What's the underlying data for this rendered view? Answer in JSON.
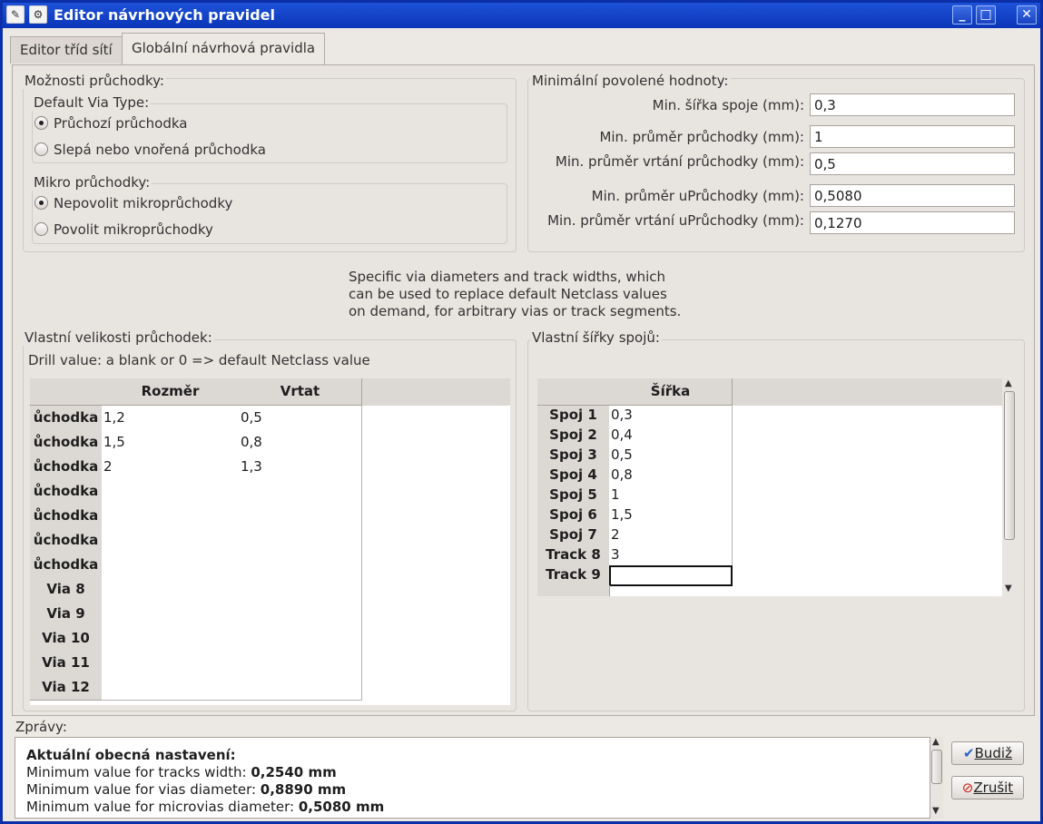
{
  "window": {
    "title": "Editor návrhových pravidel"
  },
  "tabs": [
    "Editor tříd sítí",
    "Globální návrhová pravidla"
  ],
  "via_options": {
    "title": "Možnosti průchodky:",
    "default_type": {
      "title": "Default Via Type:",
      "options": [
        "Průchozí průchodka",
        "Slepá nebo vnořená průchodka"
      ],
      "selected": 0
    },
    "micro": {
      "title": "Mikro průchodky:",
      "options": [
        "Nepovolit mikroprůchodky",
        "Povolit mikroprůchodky"
      ],
      "selected": 0
    }
  },
  "min_values": {
    "title": "Minimální povolené hodnoty:",
    "fields": [
      {
        "label": "Min. šířka spoje (mm):",
        "value": "0,3"
      },
      {
        "label": "Min. průměr průchodky (mm):",
        "value": "1"
      },
      {
        "label": "Min. průměr vrtání průchodky (mm):",
        "value": "0,5"
      },
      {
        "label": "Min. průměr uPrůchodky (mm):",
        "value": "0,5080"
      },
      {
        "label": "Min. průměr vrtání uPrůchodky (mm):",
        "value": "0,1270"
      }
    ]
  },
  "info_text": [
    "Specific via diameters and track widths, which",
    "can be used to replace default Netclass values",
    "on demand, for arbitrary vias or track segments."
  ],
  "via_sizes": {
    "title": "Vlastní velikosti průchodek:",
    "note": "Drill value: a blank or 0 => default Netclass value",
    "columns": [
      "Rozměr",
      "Vrtat"
    ],
    "rows": [
      {
        "label": "ůchodka",
        "size": "1,2",
        "drill": "0,5"
      },
      {
        "label": "ůchodka",
        "size": "1,5",
        "drill": "0,8"
      },
      {
        "label": "ůchodka",
        "size": "2",
        "drill": "1,3"
      },
      {
        "label": "ůchodka",
        "size": "",
        "drill": ""
      },
      {
        "label": "ůchodka",
        "size": "",
        "drill": ""
      },
      {
        "label": "ůchodka",
        "size": "",
        "drill": ""
      },
      {
        "label": "ůchodka",
        "size": "",
        "drill": ""
      },
      {
        "label": "Via 8",
        "size": "",
        "drill": ""
      },
      {
        "label": "Via 9",
        "size": "",
        "drill": ""
      },
      {
        "label": "Via 10",
        "size": "",
        "drill": ""
      },
      {
        "label": "Via 11",
        "size": "",
        "drill": ""
      },
      {
        "label": "Via 12",
        "size": "",
        "drill": ""
      }
    ]
  },
  "track_widths": {
    "title": "Vlastní šířky spojů:",
    "columns": [
      "Šířka"
    ],
    "rows": [
      {
        "label": "Spoj 1",
        "width": "0,3"
      },
      {
        "label": "Spoj 2",
        "width": "0,4"
      },
      {
        "label": "Spoj 3",
        "width": "0,5"
      },
      {
        "label": "Spoj 4",
        "width": "0,8"
      },
      {
        "label": "Spoj 5",
        "width": "1"
      },
      {
        "label": "Spoj 6",
        "width": "1,5"
      },
      {
        "label": "Spoj 7",
        "width": "2"
      },
      {
        "label": "Track 8",
        "width": "3"
      },
      {
        "label": "Track 9",
        "width": ""
      }
    ]
  },
  "messages": {
    "title": "Zprávy:",
    "heading": "Aktuální obecná nastavení:",
    "lines": [
      {
        "text": "Minimum value for tracks width: ",
        "value": "0,2540 mm"
      },
      {
        "text": "Minimum value for vias diameter: ",
        "value": "0,8890 mm"
      },
      {
        "text": "Minimum value for microvias diameter: ",
        "value": "0,5080 mm"
      }
    ]
  },
  "buttons": {
    "ok": "Budiž",
    "cancel": "Zrušit"
  }
}
